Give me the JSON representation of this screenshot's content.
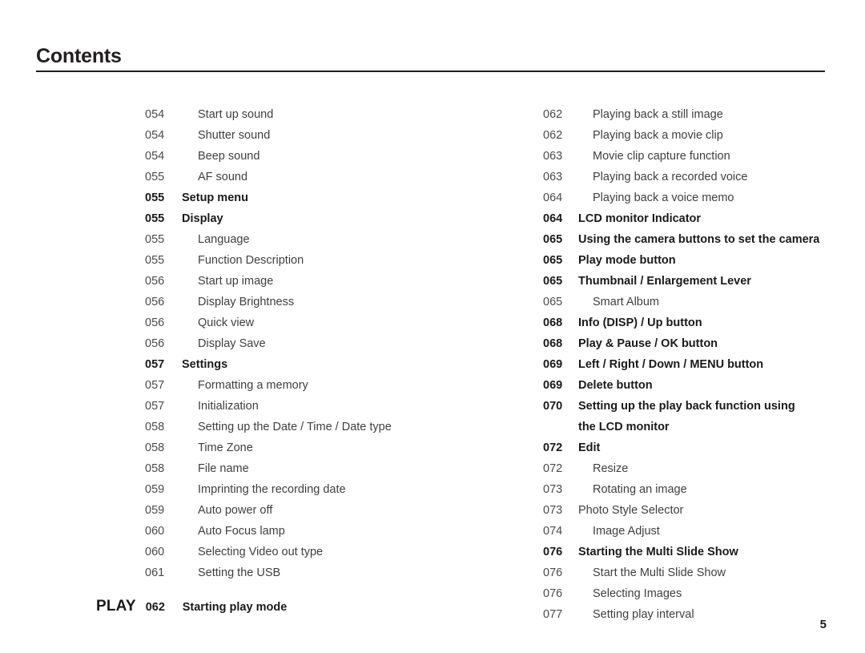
{
  "header": {
    "title": "Contents"
  },
  "footer": {
    "page_number": "5"
  },
  "play_band": {
    "tag": "PLAY",
    "number": "062",
    "label": "Starting play mode"
  },
  "left_column": [
    {
      "number": "054",
      "label": "Start up sound",
      "level": "sub",
      "bold": false
    },
    {
      "number": "054",
      "label": "Shutter sound",
      "level": "sub",
      "bold": false
    },
    {
      "number": "054",
      "label": "Beep sound",
      "level": "sub",
      "bold": false
    },
    {
      "number": "055",
      "label": "AF sound",
      "level": "sub",
      "bold": false
    },
    {
      "number": "055",
      "label": "Setup menu",
      "level": "top",
      "bold": true
    },
    {
      "number": "055",
      "label": "Display",
      "level": "top",
      "bold": true
    },
    {
      "number": "055",
      "label": "Language",
      "level": "sub",
      "bold": false
    },
    {
      "number": "055",
      "label": "Function Description",
      "level": "sub",
      "bold": false
    },
    {
      "number": "056",
      "label": "Start up image",
      "level": "sub",
      "bold": false
    },
    {
      "number": "056",
      "label": "Display Brightness",
      "level": "sub",
      "bold": false
    },
    {
      "number": "056",
      "label": "Quick view",
      "level": "sub",
      "bold": false
    },
    {
      "number": "056",
      "label": "Display Save",
      "level": "sub",
      "bold": false
    },
    {
      "number": "057",
      "label": "Settings",
      "level": "top",
      "bold": true
    },
    {
      "number": "057",
      "label": "Formatting a memory",
      "level": "sub",
      "bold": false
    },
    {
      "number": "057",
      "label": "Initialization",
      "level": "sub",
      "bold": false
    },
    {
      "number": "058",
      "label": "Setting up the Date / Time / Date type",
      "level": "sub",
      "bold": false
    },
    {
      "number": "058",
      "label": "Time Zone",
      "level": "sub",
      "bold": false
    },
    {
      "number": "058",
      "label": "File name",
      "level": "sub",
      "bold": false
    },
    {
      "number": "059",
      "label": "Imprinting the recording date",
      "level": "sub",
      "bold": false
    },
    {
      "number": "059",
      "label": "Auto power off",
      "level": "sub",
      "bold": false
    },
    {
      "number": "060",
      "label": "Auto Focus lamp",
      "level": "sub",
      "bold": false
    },
    {
      "number": "060",
      "label": "Selecting Video out type",
      "level": "sub",
      "bold": false
    },
    {
      "number": "061",
      "label": "Setting the USB",
      "level": "sub",
      "bold": false
    }
  ],
  "right_column": [
    {
      "number": "062",
      "label": "Playing back a still image",
      "level": "sub",
      "bold": false
    },
    {
      "number": "062",
      "label": "Playing back a movie clip",
      "level": "sub",
      "bold": false
    },
    {
      "number": "063",
      "label": "Movie clip capture function",
      "level": "sub",
      "bold": false
    },
    {
      "number": "063",
      "label": "Playing back a recorded voice",
      "level": "sub",
      "bold": false
    },
    {
      "number": "064",
      "label": "Playing back a voice memo",
      "level": "sub",
      "bold": false
    },
    {
      "number": "064",
      "label": "LCD monitor Indicator",
      "level": "top",
      "bold": true
    },
    {
      "number": "065",
      "label": "Using the camera buttons to set the camera",
      "level": "top",
      "bold": true
    },
    {
      "number": "065",
      "label": "Play mode button",
      "level": "top",
      "bold": true
    },
    {
      "number": "065",
      "label": "Thumbnail / Enlargement Lever",
      "level": "top",
      "bold": true
    },
    {
      "number": "065",
      "label": "Smart Album",
      "level": "sub",
      "bold": false
    },
    {
      "number": "068",
      "label": "Info (DISP) / Up button",
      "level": "top",
      "bold": true
    },
    {
      "number": "068",
      "label": "Play & Pause / OK button",
      "level": "top",
      "bold": true
    },
    {
      "number": "069",
      "label": "Left / Right / Down / MENU button",
      "level": "top",
      "bold": true
    },
    {
      "number": "069",
      "label": "Delete button",
      "level": "top",
      "bold": true
    },
    {
      "number": "070",
      "label": "Setting up the play back function using",
      "level": "top",
      "bold": true
    },
    {
      "number": "",
      "label": "the LCD monitor",
      "level": "top",
      "bold": true,
      "continuation": true
    },
    {
      "number": "072",
      "label": "Edit",
      "level": "top",
      "bold": true
    },
    {
      "number": "072",
      "label": "Resize",
      "level": "sub",
      "bold": false
    },
    {
      "number": "073",
      "label": "Rotating an image",
      "level": "sub",
      "bold": false
    },
    {
      "number": "073",
      "label": "Photo Style Selector",
      "level": "top",
      "bold": false
    },
    {
      "number": "074",
      "label": "Image Adjust",
      "level": "sub",
      "bold": false
    },
    {
      "number": "076",
      "label": "Starting the Multi Slide Show",
      "level": "top",
      "bold": true
    },
    {
      "number": "076",
      "label": "Start the Multi Slide Show",
      "level": "sub",
      "bold": false
    },
    {
      "number": "076",
      "label": "Selecting Images",
      "level": "sub",
      "bold": false
    },
    {
      "number": "077",
      "label": "Setting play interval",
      "level": "sub",
      "bold": false
    }
  ]
}
